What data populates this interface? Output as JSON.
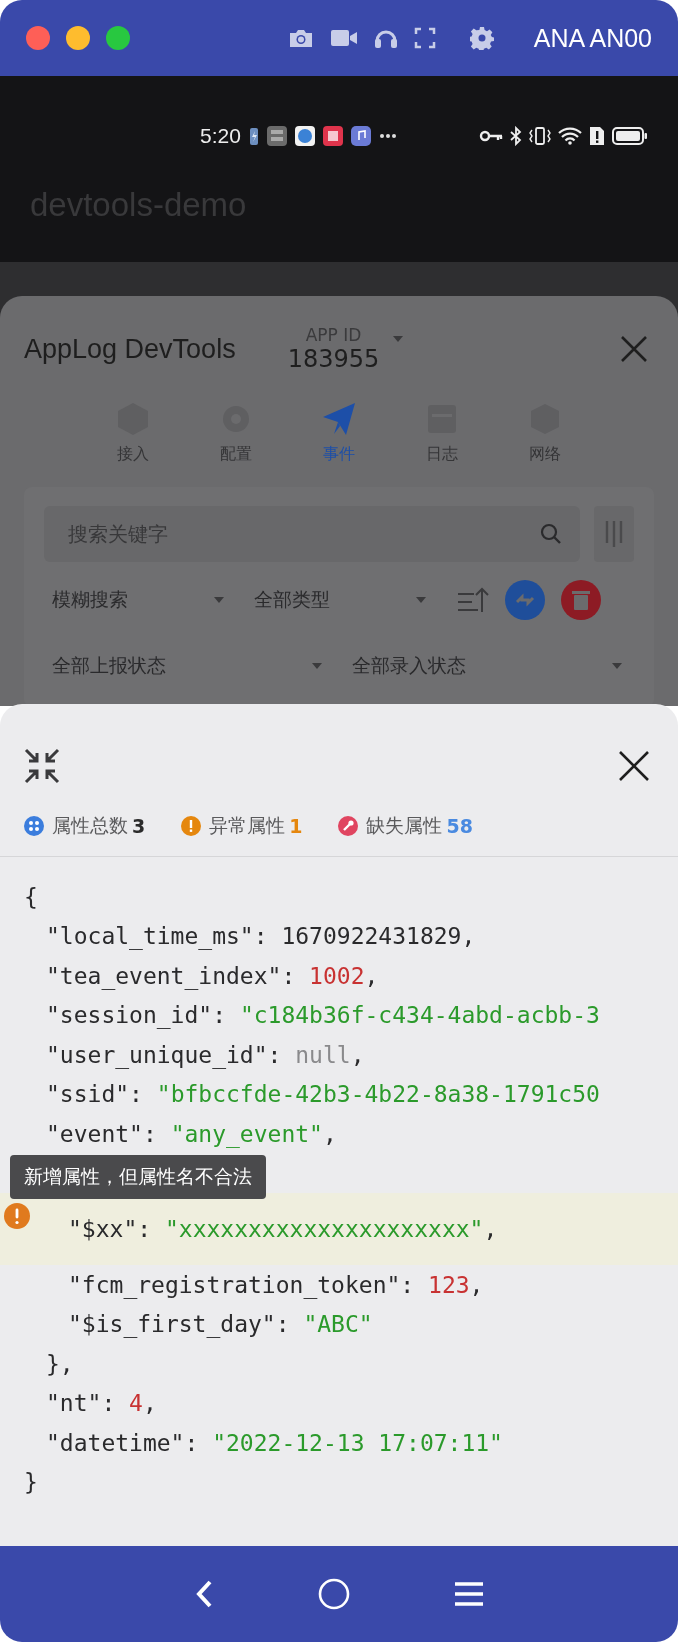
{
  "window": {
    "title": "ANA AN00"
  },
  "status_bar": {
    "time": "5:20"
  },
  "app_bar": {
    "title": "devtools-demo"
  },
  "devtools": {
    "title": "AppLog DevTools",
    "app_id_label": "APP ID",
    "app_id": "183955",
    "tabs": [
      {
        "label": "接入",
        "selected": false
      },
      {
        "label": "配置",
        "selected": false
      },
      {
        "label": "事件",
        "selected": true
      },
      {
        "label": "日志",
        "selected": false
      },
      {
        "label": "网络",
        "selected": false
      }
    ],
    "search": {
      "placeholder": "搜索关键字"
    },
    "filters": [
      {
        "value": "模糊搜索"
      },
      {
        "value": "全部类型"
      }
    ],
    "status_filters": [
      {
        "value": "全部上报状态"
      },
      {
        "value": "全部录入状态"
      }
    ]
  },
  "detail": {
    "stats": [
      {
        "kind": "total",
        "label": "属性总数",
        "count": "3",
        "color": "#3b7ddd"
      },
      {
        "kind": "warning",
        "label": "异常属性",
        "count": "1",
        "color": "#e5870e"
      },
      {
        "kind": "missing",
        "label": "缺失属性",
        "count": "58",
        "color": "#e04560"
      }
    ],
    "code": {
      "open": "{",
      "close": "}",
      "entries": [
        {
          "key": "\"local_time_ms\":",
          "value": "1670922431829",
          "kind": "plain",
          "tail": ","
        },
        {
          "key": "\"tea_event_index\":",
          "value": "1002",
          "kind": "number",
          "tail": ","
        },
        {
          "key": "\"session_id\":",
          "value": "\"c184b36f-c434-4abd-acbb-3",
          "kind": "string"
        },
        {
          "key": "\"user_unique_id\":",
          "value": "null",
          "kind": "null",
          "tail": ","
        },
        {
          "key": "\"ssid\":",
          "value": "\"bfbccfde-42b3-4b22-8a38-1791c50",
          "kind": "string"
        },
        {
          "key": "\"event\":",
          "value": "\"any_event\"",
          "kind": "string",
          "tail": ","
        },
        {
          "kind": "object",
          "close": "},",
          "children": [
            {
              "key": "\"$xx\":",
              "value": "\"xxxxxxxxxxxxxxxxxxxxx\"",
              "kind": "string",
              "tail": ",",
              "warning": true
            },
            {
              "key": "\"fcm_registration_token\":",
              "value": "123",
              "kind": "number",
              "tail": ",",
              "warning": false
            },
            {
              "key": "\"$is_first_day\":",
              "value": "\"ABC\"",
              "kind": "string",
              "warning": false
            }
          ]
        },
        {
          "key": "\"nt\":",
          "value": "4",
          "kind": "number",
          "tail": ","
        },
        {
          "key": "\"datetime\":",
          "value": "\"2022-12-13 17:07:11\"",
          "kind": "string"
        }
      ]
    },
    "tooltip": "新增属性，但属性名不合法"
  }
}
